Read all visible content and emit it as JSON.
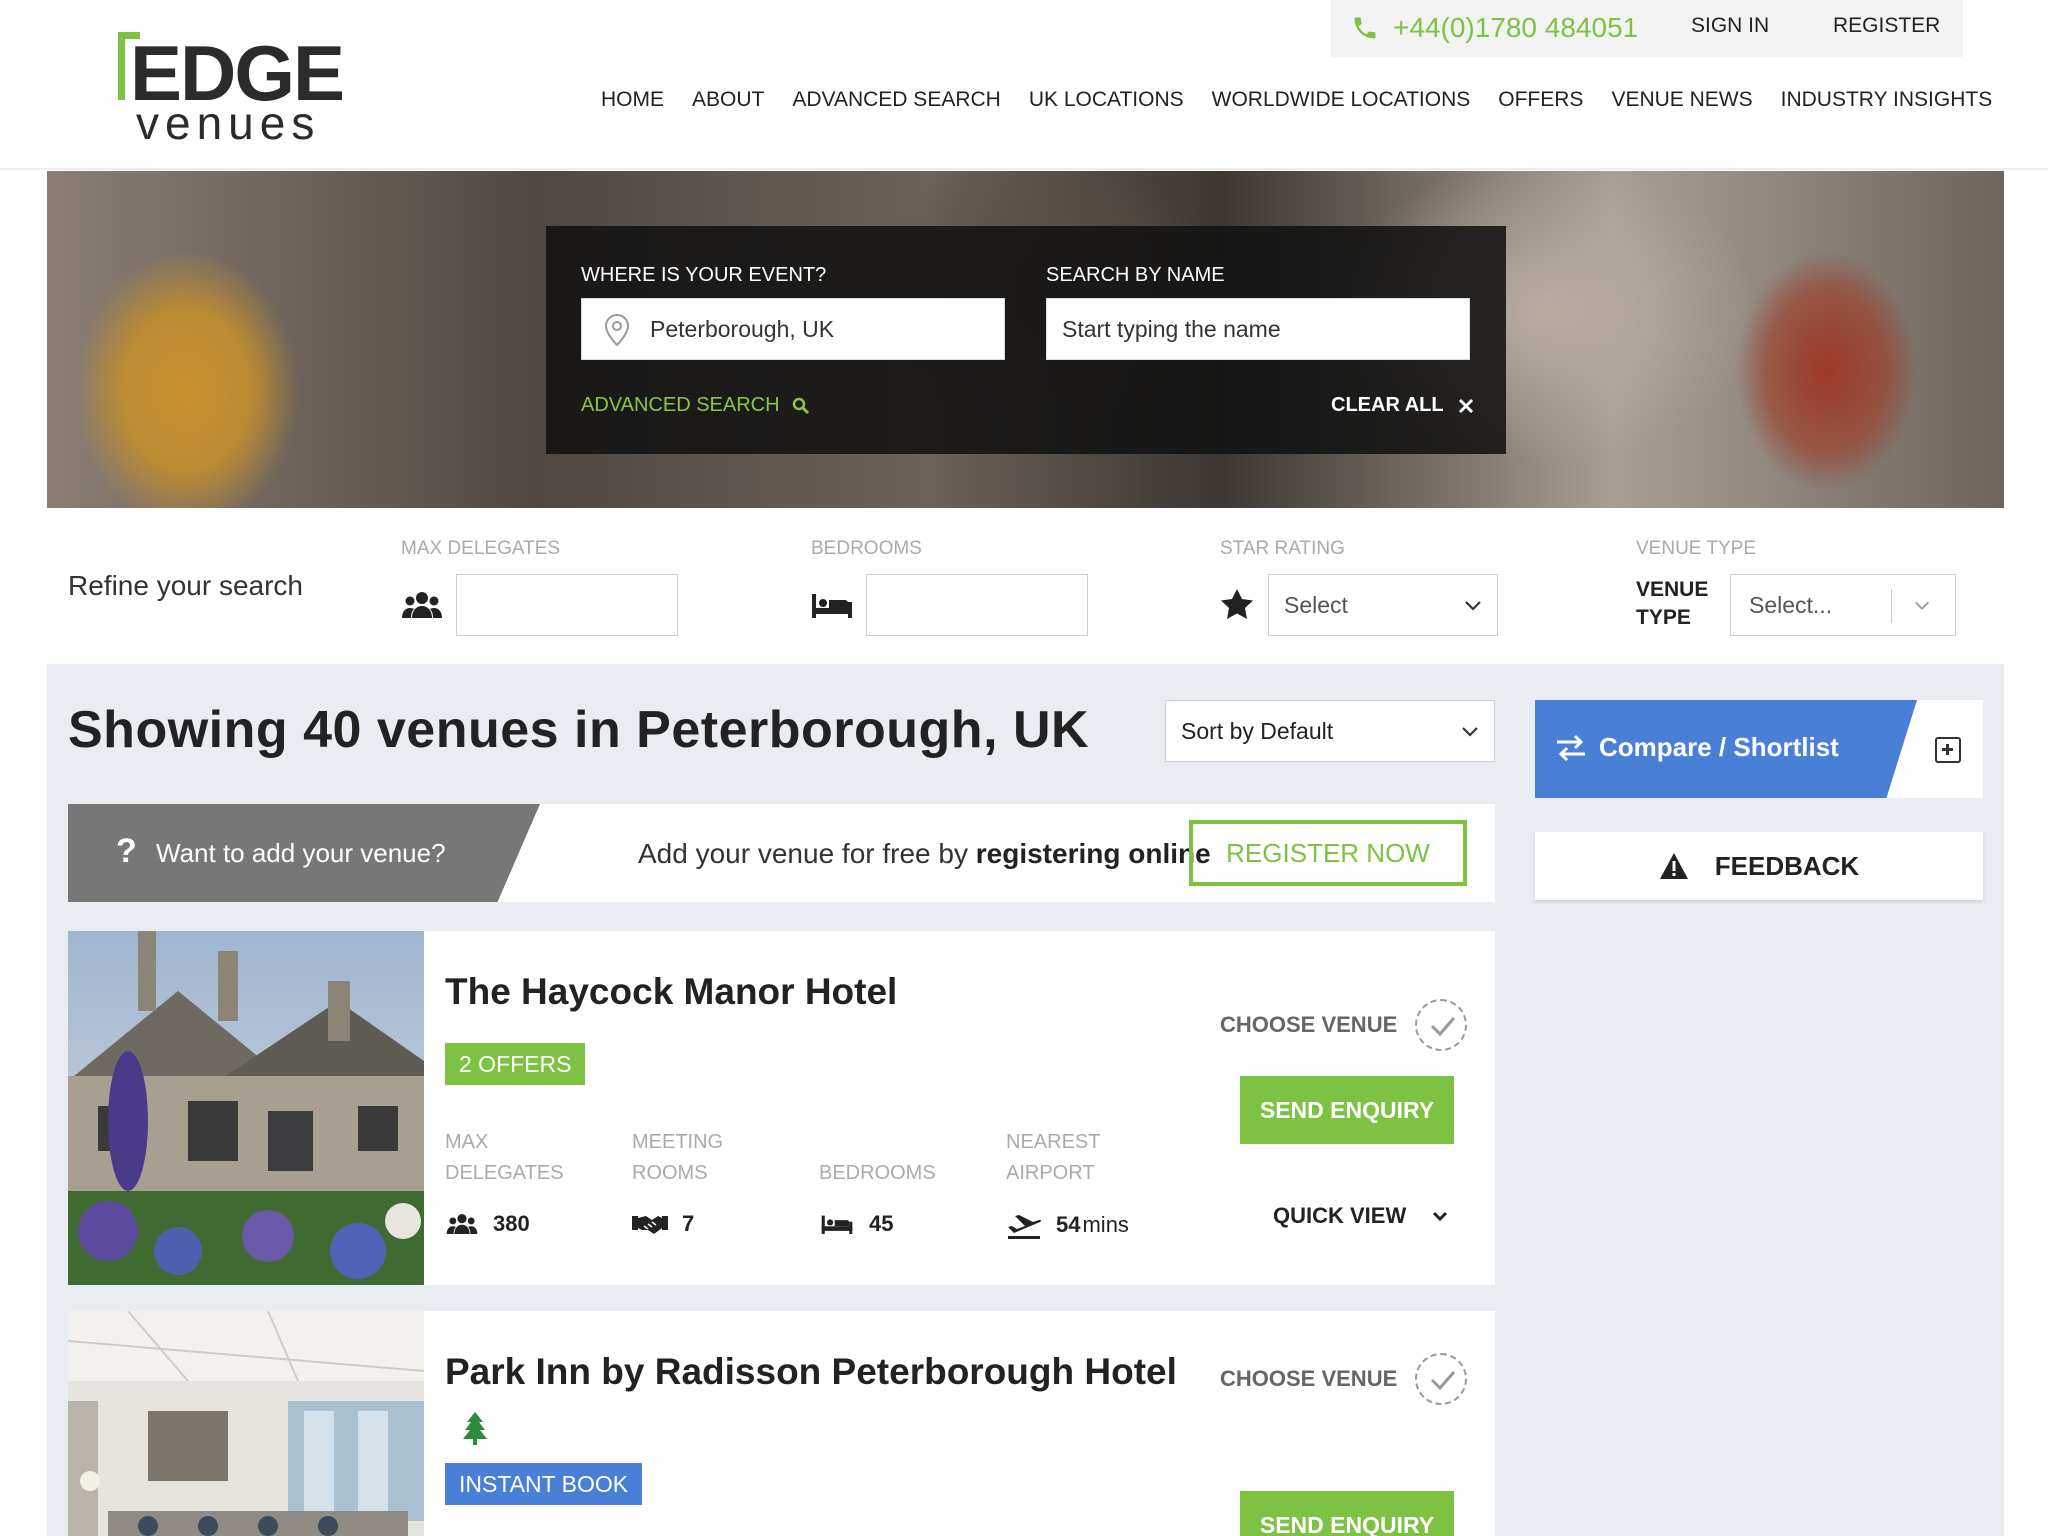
{
  "brand": {
    "logo_main": "EDGE",
    "logo_sub": "venues",
    "accent": "#7dc242",
    "blue": "#4a7fd8"
  },
  "topbar": {
    "phone": "+44(0)1780 484051",
    "sign_in": "SIGN IN",
    "register": "REGISTER"
  },
  "nav": [
    "HOME",
    "ABOUT",
    "ADVANCED SEARCH",
    "UK LOCATIONS",
    "WORLDWIDE LOCATIONS",
    "OFFERS",
    "VENUE NEWS",
    "INDUSTRY INSIGHTS"
  ],
  "search": {
    "where_label": "WHERE IS YOUR EVENT?",
    "where_value": "Peterborough, UK",
    "name_label": "SEARCH BY NAME",
    "name_placeholder": "Start typing the name",
    "advanced": "ADVANCED SEARCH",
    "clear_all": "CLEAR ALL"
  },
  "refine": {
    "title": "Refine your search",
    "max_delegates": "MAX DELEGATES",
    "bedrooms": "BEDROOMS",
    "star_rating": "STAR RATING",
    "star_select": "Select",
    "venue_type": "VENUE TYPE",
    "venue_type_inline": "VENUE TYPE",
    "venue_type_select": "Select..."
  },
  "results": {
    "title": "Showing 40 venues in Peterborough, UK",
    "sort": "Sort by Default"
  },
  "add_venue": {
    "question": "?",
    "prompt": "Want to add your venue?",
    "message_plain": "Add your venue for free by ",
    "message_bold": "registering online",
    "button": "REGISTER NOW"
  },
  "compare": {
    "label": "Compare / Shortlist"
  },
  "feedback": {
    "label": "FEEDBACK"
  },
  "venues": [
    {
      "name": "The Haycock Manor Hotel",
      "badge": "2 OFFERS",
      "choose": "CHOOSE VENUE",
      "enquiry": "SEND ENQUIRY",
      "quick_view": "QUICK VIEW",
      "stats": {
        "max_delegates_label": "MAX DELEGATES",
        "meeting_rooms_label": "MEETING ROOMS",
        "bedrooms_label": "BEDROOMS",
        "airport_label": "NEAREST AIRPORT",
        "max_delegates": "380",
        "meeting_rooms": "7",
        "bedrooms": "45",
        "airport": "54",
        "airport_unit": "mins"
      }
    },
    {
      "name": "Park Inn by Radisson Peterborough Hotel",
      "badge": "INSTANT BOOK",
      "choose": "CHOOSE VENUE",
      "enquiry": "SEND ENQUIRY",
      "icon": "tree-icon"
    }
  ]
}
